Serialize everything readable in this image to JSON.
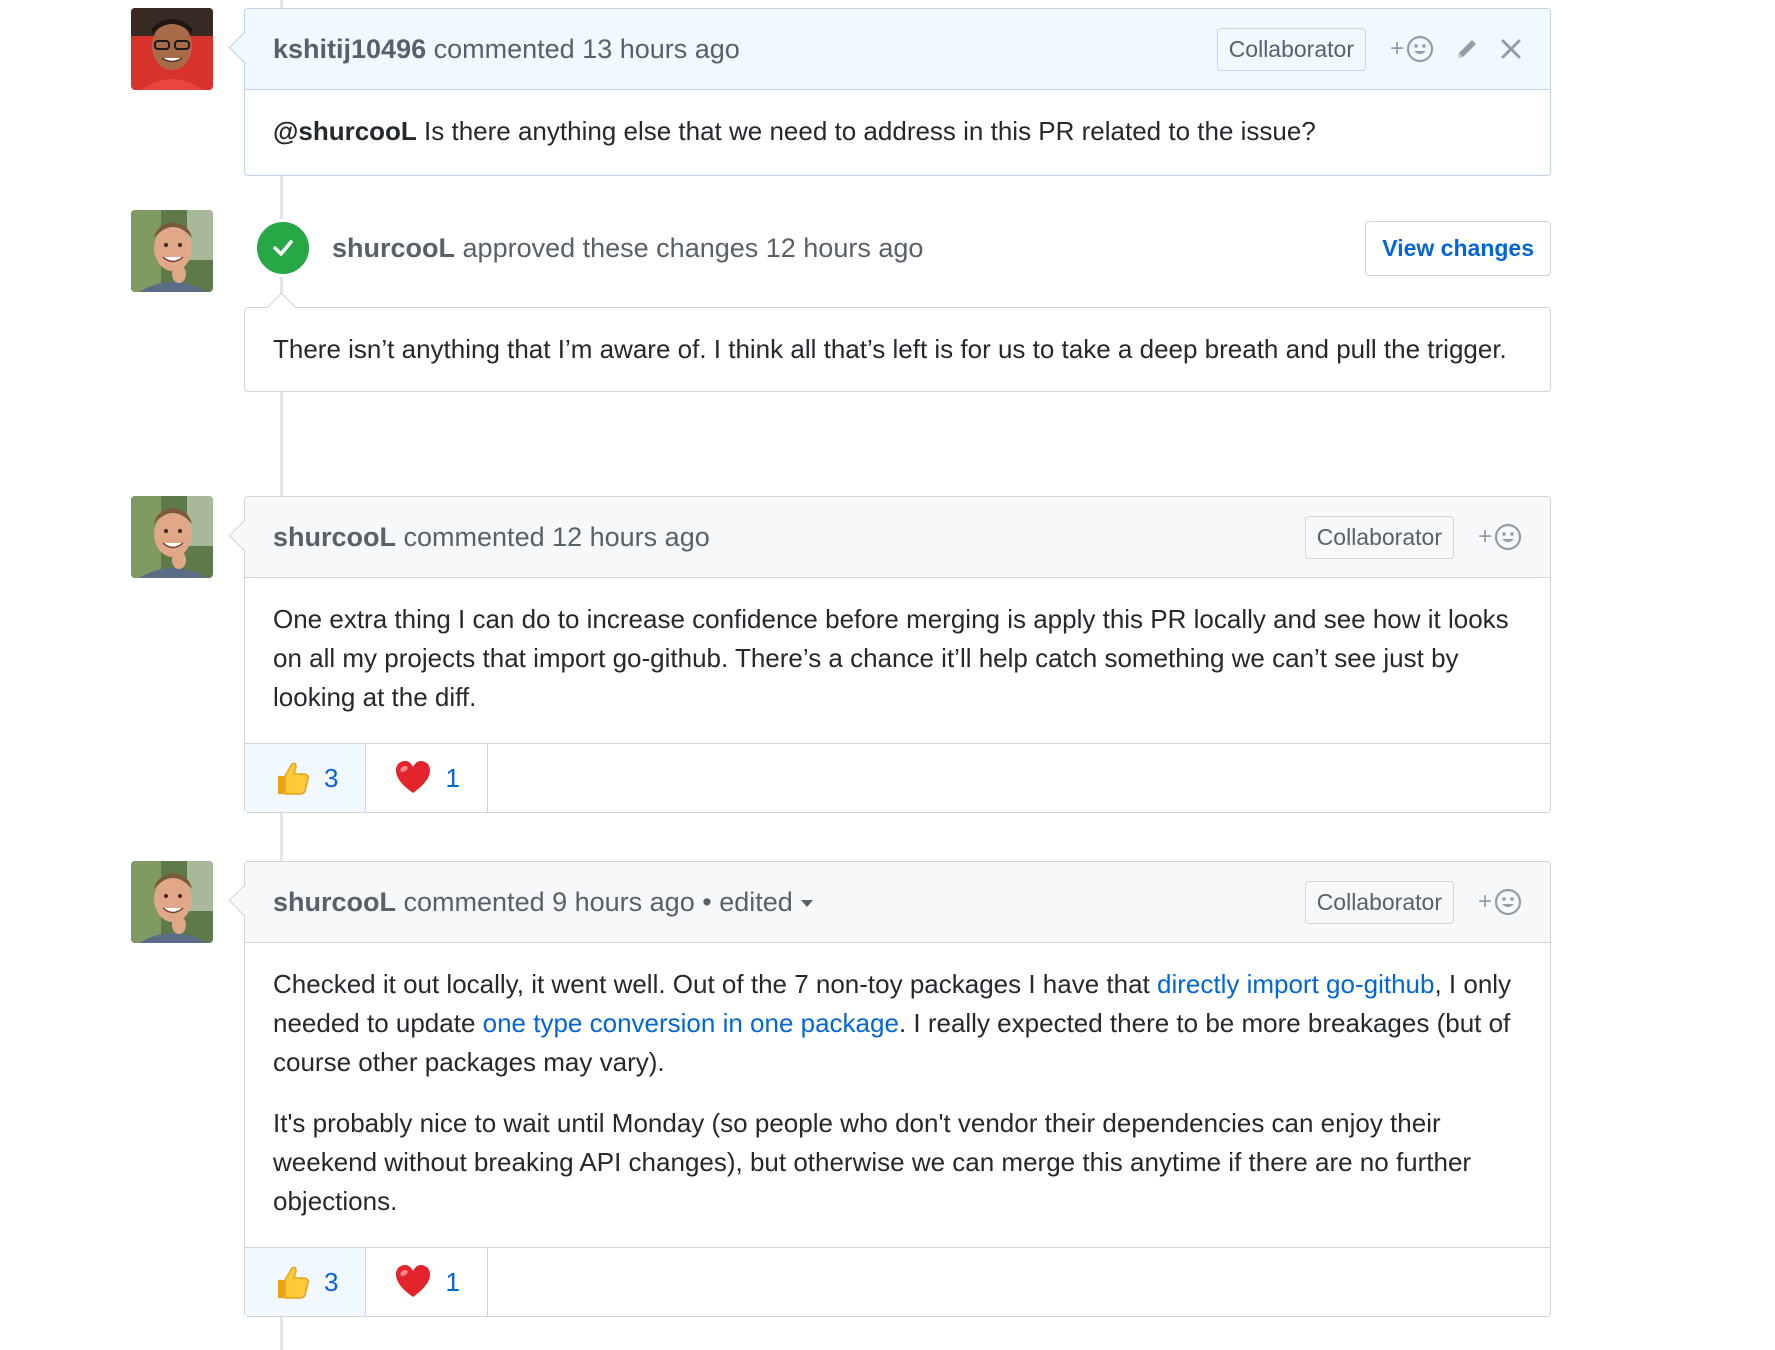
{
  "comments": [
    {
      "author": "kshitij10496",
      "action": "commented 13 hours ago",
      "badge": "Collaborator",
      "react_plus": "+",
      "body_mention": "@shurcooL",
      "body_text": " Is there anything else that we need to address in this PR related to the issue?"
    },
    {
      "author": "shurcooL",
      "action": "commented 12 hours ago",
      "badge": "Collaborator",
      "react_plus": "+",
      "body": "One extra thing I can do to increase confidence before merging is apply this PR locally and see how it looks on all my projects that import go-github. There’s a chance it’ll help catch something we can’t see just by looking at the diff.",
      "reactions": [
        {
          "emoji": "thumbs-up",
          "count": "3"
        },
        {
          "emoji": "heart",
          "count": "1"
        }
      ]
    },
    {
      "author": "shurcooL",
      "action": "commented 9 hours ago",
      "separator": " • ",
      "edited": "edited",
      "badge": "Collaborator",
      "react_plus": "+",
      "p1_a": "Checked it out locally, it went well. Out of the 7 non-toy packages I have that ",
      "p1_link1": "directly import go-github",
      "p1_b": ", I only needed to update ",
      "p1_link2": "one type conversion in one package",
      "p1_c": ". I really expected there to be more breakages (but of course other packages may vary).",
      "p2": "It's probably nice to wait until Monday (so people who don't vendor their dependencies can enjoy their weekend without breaking API changes), but otherwise we can merge this anytime if there are no further objections.",
      "reactions": [
        {
          "emoji": "thumbs-up",
          "count": "3"
        },
        {
          "emoji": "heart",
          "count": "1"
        }
      ]
    }
  ],
  "review": {
    "author": "shurcooL",
    "action": "approved these changes 12 hours ago",
    "button": "View changes",
    "body": "There isn’t anything that I’m aware of. I think all that’s left is for us to take a deep breath and pull the trigger."
  },
  "colors": {
    "link": "#0366d6",
    "approved": "#28a745",
    "border": "#d1d5da",
    "highlight_header": "#f1f8ff"
  }
}
